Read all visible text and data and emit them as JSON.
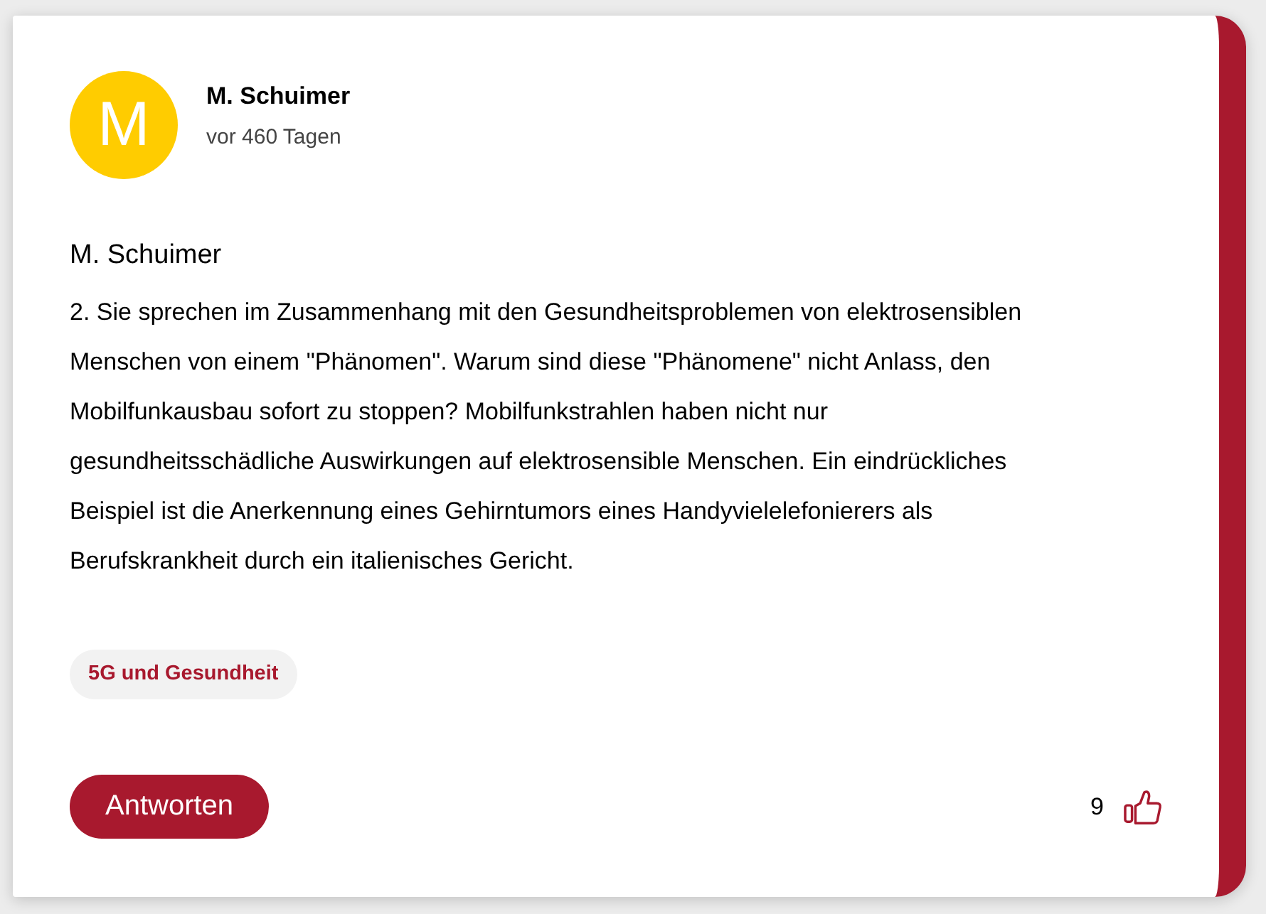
{
  "author": {
    "initial": "M",
    "name": "M. Schuimer",
    "time": "vor 460 Tagen"
  },
  "post": {
    "title": "M. Schuimer",
    "body": "2. Sie sprechen im Zusammenhang mit den Gesundheitsproblemen von elektrosensiblen Menschen von einem \"Phänomen\". Warum sind diese \"Phänomene\" nicht Anlass, den Mobilfunkausbau sofort zu stoppen? Mobilfunkstrahlen haben nicht nur gesundheitsschädliche Auswirkungen auf elektrosensible Menschen. Ein eindrückliches Beispiel ist die Anerkennung eines Gehirntumors eines Handyvielelefonierers als Berufskrankheit durch ein italienisches Gericht."
  },
  "tags": [
    {
      "label": "5G und Gesundheit"
    }
  ],
  "actions": {
    "reply_button": "Antworten",
    "like_count": "9"
  }
}
